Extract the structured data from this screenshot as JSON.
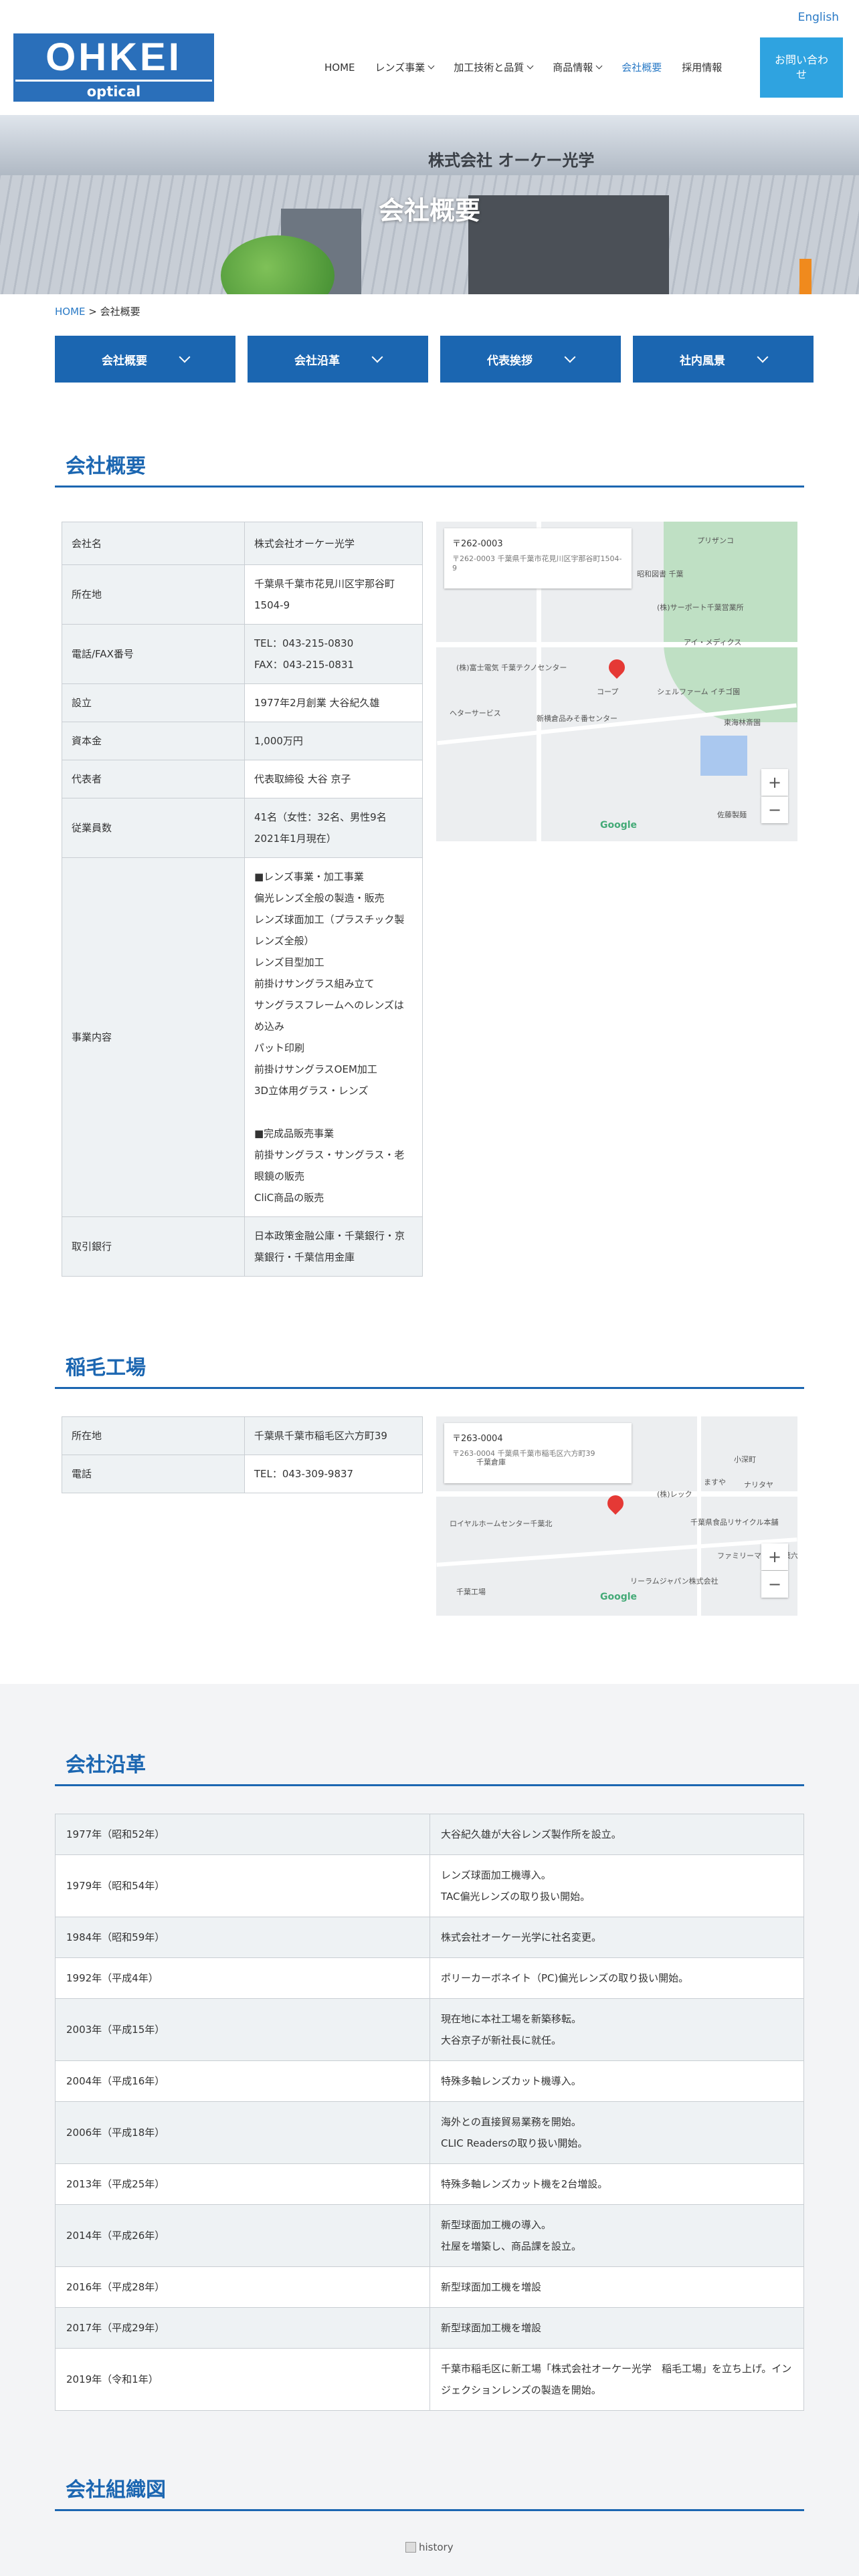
{
  "header": {
    "lang_label": "English",
    "logo_main": "OHKEI",
    "logo_sub": "optical",
    "nav": [
      {
        "label": "HOME",
        "dropdown": false
      },
      {
        "label": "レンズ事業",
        "dropdown": true
      },
      {
        "label": "加工技術と品質",
        "dropdown": true
      },
      {
        "label": "商品情報",
        "dropdown": true
      },
      {
        "label": "会社概要",
        "dropdown": false,
        "active": true
      },
      {
        "label": "採用情報",
        "dropdown": false
      }
    ],
    "contact_label": "お問い合わせ"
  },
  "hero": {
    "title": "会社概要",
    "sign_text": "株式会社 オーケー光学"
  },
  "breadcrumb": {
    "home": "HOME",
    "separator": " > ",
    "current": "会社概要"
  },
  "tabs": [
    {
      "label": "会社概要"
    },
    {
      "label": "会社沿革"
    },
    {
      "label": "代表挨拶"
    },
    {
      "label": "社内風景"
    }
  ],
  "overview": {
    "title": "会社概要",
    "rows": [
      {
        "label": "会社名",
        "value": "株式会社オーケー光学"
      },
      {
        "label": "所在地",
        "value": "千葉県千葉市花見川区宇那谷町1504-9"
      },
      {
        "label": "電話/FAX番号",
        "value": "TEL：043-215-0830\nFAX：043-215-0831"
      },
      {
        "label": "設立",
        "value": "1977年2月創業 大谷紀久雄"
      },
      {
        "label": "資本金",
        "value": "1,000万円"
      },
      {
        "label": "代表者",
        "value": "代表取締役 大谷 京子"
      },
      {
        "label": "従業員数",
        "value": "41名（女性：32名、男性9名\n2021年1月現在）"
      },
      {
        "label": "事業内容",
        "value": "■レンズ事業・加工事業\n偏光レンズ全般の製造・販売\nレンズ球面加工（プラスチック製レンズ全般）\nレンズ目型加工\n前掛けサングラス組み立て\nサングラスフレームへのレンズはめ込み\nパット印刷\n前掛けサングラスOEM加工\n3D立体用グラス・レンズ\n\n■完成品販売事業\n前掛サングラス・サングラス・老眼鏡の販売\nCliC商品の販売"
      },
      {
        "label": "取引銀行",
        "value": "日本政策金融公庫・千葉銀行・京葉銀行・千葉信用金庫"
      }
    ],
    "map": {
      "card_title": "〒262-0003",
      "card_sub": "〒262-0003 千葉県千葉市花見川区宇那谷町1504-9",
      "pois": [
        "プリザンコ",
        "(株)サーポート千葉営業所",
        "昭和図書 千葉",
        "(株)富士電気 千葉テクノセンター",
        "アイ・メディクス",
        "シェルファーム イチゴ園",
        "東海林斎園",
        "新横倉品みそ番センター",
        "ヘターサービス",
        "佐藤製麺",
        "コープ"
      ],
      "google": "Google"
    }
  },
  "factory": {
    "title": "稲毛工場",
    "rows": [
      {
        "label": "所在地",
        "value": "千葉県千葉市稲毛区六方町39"
      },
      {
        "label": "電話",
        "value": "TEL：043-309-9837"
      }
    ],
    "map": {
      "card_title": "〒263-0004",
      "card_sub": "〒263-0004 千葉県千葉市稲毛区六方町39",
      "pois": [
        "小深町",
        "ますや",
        "(株)レック",
        "ナリタヤ",
        "ロイヤルホームセンター千葉北",
        "ファミリーマート千葉六方町",
        "千葉県食品リサイクル本舗",
        "千葉工場",
        "リーラムジャパン株式会社",
        "千葉倉庫"
      ],
      "google": "Google"
    }
  },
  "history": {
    "title": "会社沿革",
    "rows": [
      {
        "year": "1977年（昭和52年）",
        "event": "大谷紀久雄が大谷レンズ製作所を設立。"
      },
      {
        "year": "1979年（昭和54年）",
        "event": "レンズ球面加工機導入。\nTAC偏光レンズの取り扱い開始。"
      },
      {
        "year": "1984年（昭和59年）",
        "event": "株式会社オーケー光学に社名変更。"
      },
      {
        "year": "1992年（平成4年）",
        "event": "ポリーカーボネイト（PC)偏光レンズの取り扱い開始。"
      },
      {
        "year": "2003年（平成15年）",
        "event": "現在地に本社工場を新築移転。\n大谷京子が新社長に就任。"
      },
      {
        "year": "2004年（平成16年）",
        "event": "特殊多軸レンズカット機導入。"
      },
      {
        "year": "2006年（平成18年）",
        "event": "海外との直接貿易業務を開始。\nCLIC Readersの取り扱い開始。"
      },
      {
        "year": "2013年（平成25年）",
        "event": "特殊多軸レンズカット機を2台増設。"
      },
      {
        "year": "2014年（平成26年）",
        "event": "新型球面加工機の導入。\n社屋を増築し、商品課を設立。"
      },
      {
        "year": "2016年（平成28年）",
        "event": "新型球面加工機を増設"
      },
      {
        "year": "2017年（平成29年）",
        "event": "新型球面加工機を増設"
      },
      {
        "year": "2019年（令和1年）",
        "event": "千葉市稲毛区に新工場「株式会社オーケー光学　稲毛工場」を立ち上げ。インジェクションレンズの製造を開始。"
      }
    ]
  },
  "org": {
    "title": "会社組織図",
    "img_alt": "history"
  },
  "colors": {
    "brand": "#1b66b1",
    "accent": "#2fa3e0",
    "link": "#2a7ac6",
    "table_label_bg": "#eef2f4"
  }
}
